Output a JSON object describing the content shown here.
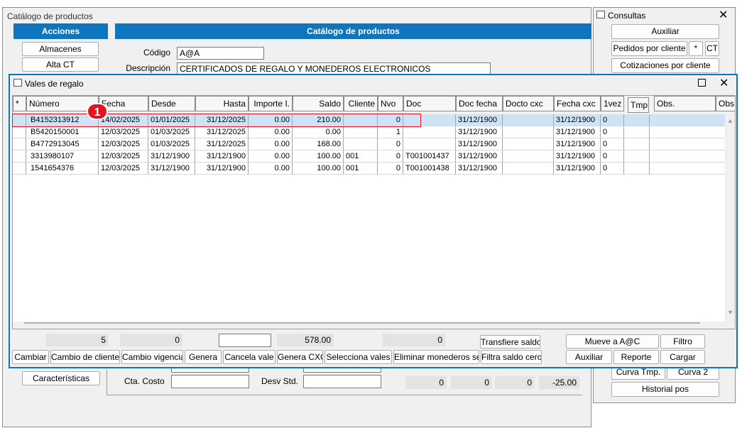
{
  "main_window": {
    "title": "Catálogo de productos",
    "acciones_header": "Acciones",
    "catalog_header": "Catálogo de productos",
    "almacenes_button": "Almacenes",
    "alta_ct_button": "Alta CT",
    "codigo_label": "Código",
    "codigo_value": "A@A",
    "descripcion_label": "Descripción",
    "descripcion_value": "CERTIFICADOS DE REGALO Y MONEDEROS ELECTRONICOS",
    "caracteristicas_button": "Características",
    "cta_costo_label": "Cta. Costo",
    "desv_std_label": "Desv Std.",
    "bottom_values": [
      "0",
      "0",
      "0",
      "-25.00"
    ]
  },
  "consultas": {
    "title": "Consultas",
    "auxiliar_button": "Auxiliar",
    "pedidos_button": "Pedidos por cliente",
    "star_button": "*",
    "ct_button": "CT",
    "cotizaciones_button": "Cotizaciones por cliente",
    "curva_tmp_button": "Curva Tmp.",
    "curva2_button": "Curva 2",
    "historial_button": "Historial pos"
  },
  "vales": {
    "title": "Vales de regalo",
    "badge": "1",
    "columns": [
      "*",
      "Número",
      "Fecha",
      "Desde",
      "Hasta",
      "Importe I.",
      "Saldo",
      "Cliente",
      "Nvo",
      "Doc",
      "Doc fecha",
      "Docto cxc",
      "Fecha cxc",
      "1vez",
      "Tmp.",
      "Obs.",
      "Obs."
    ],
    "rows": [
      [
        "",
        "B4152313912",
        "14/02/2025",
        "01/01/2025",
        "31/12/2025",
        "0.00",
        "210.00",
        "",
        "0",
        "",
        "31/12/1900",
        "",
        "31/12/1900",
        "0",
        "",
        "",
        ""
      ],
      [
        "",
        "B5420150001",
        "12/03/2025",
        "01/03/2025",
        "31/12/2025",
        "0.00",
        "0.00",
        "",
        "1",
        "",
        "31/12/1900",
        "",
        "31/12/1900",
        "0",
        "",
        "",
        ""
      ],
      [
        "",
        "B4772913045",
        "12/03/2025",
        "01/03/2025",
        "31/12/2025",
        "0.00",
        "168.00",
        "",
        "0",
        "",
        "31/12/1900",
        "",
        "31/12/1900",
        "0",
        "",
        "",
        ""
      ],
      [
        "",
        "3313980107",
        "12/03/2025",
        "31/12/1900",
        "31/12/1900",
        "0.00",
        "100.00",
        "001",
        "0",
        "T001001437",
        "31/12/1900",
        "",
        "31/12/1900",
        "0",
        "",
        "",
        ""
      ],
      [
        "",
        "1541654376",
        "12/03/2025",
        "31/12/1900",
        "31/12/1900",
        "0.00",
        "100.00",
        "001",
        "0",
        "T001001438",
        "31/12/1900",
        "",
        "31/12/1900",
        "0",
        "",
        "",
        ""
      ]
    ],
    "totals": [
      "5",
      "0",
      "",
      "578.00",
      "0"
    ],
    "buttons": {
      "transfiere_saldo": "Transfiere saldo",
      "mueve": "Mueve a A@C",
      "filtro": "Filtro",
      "cambiar": "Cambiar",
      "cambio_cliente": "Cambio de cliente",
      "cambio_vigencia": "Cambio vigencia",
      "genera": "Genera",
      "cancela_vale": "Cancela vale",
      "genera_cxc": "Genera CXC",
      "selecciona_vales": "Selecciona vales",
      "eliminar_monederos": "Eliminar monederos sel",
      "filtra_saldo_cero": "Filtra saldo cero",
      "auxiliar": "Auxiliar",
      "reporte": "Reporte",
      "cargar": "Cargar"
    }
  },
  "colors": {
    "accent_blue": "#0f75bc",
    "badge_red": "#e81123",
    "selected_row": "#cfe3f6"
  }
}
